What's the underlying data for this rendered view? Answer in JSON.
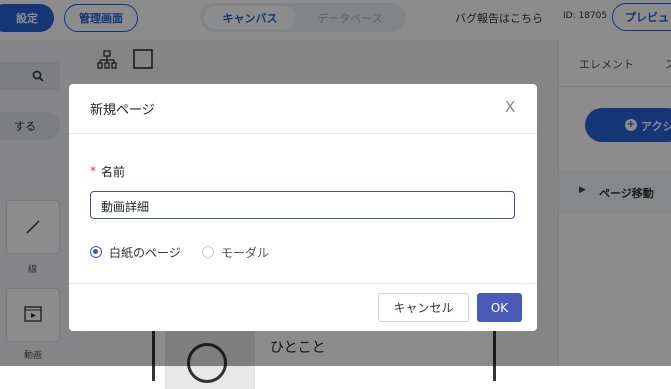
{
  "header": {
    "settings_label": "設定",
    "admin_label": "管理画面",
    "tabs": [
      {
        "label": "キャンバス",
        "active": true
      },
      {
        "label": "データベース",
        "active": false
      }
    ],
    "bug_report_label": "バグ報告はこちら",
    "id_label": "ID: 18705",
    "preview_label": "プレビュ"
  },
  "left_panel": {
    "action_label": "する",
    "components": [
      {
        "label": "線",
        "icon": "line-icon"
      },
      {
        "label": "動画",
        "icon": "video-icon"
      }
    ]
  },
  "canvas": {
    "card_text": "ひとこと"
  },
  "right_panel": {
    "tab_label": "エレメント",
    "tab_label_2": "ス",
    "add_action_label": "アクシ",
    "page_transition_label": "ページ移動"
  },
  "dialog": {
    "title": "新規ページ",
    "close_label": "X",
    "required_mark": "*",
    "name_label": "名前",
    "name_value": "動画詳細",
    "options": [
      {
        "label": "白紙のページ",
        "selected": true
      },
      {
        "label": "モーダル",
        "selected": false
      }
    ],
    "cancel_label": "キャンセル",
    "ok_label": "OK"
  },
  "colors": {
    "primary": "#2563d9",
    "ok_button": "#4a5bb6",
    "required": "#e53935",
    "input_border": "#3f51b5"
  }
}
